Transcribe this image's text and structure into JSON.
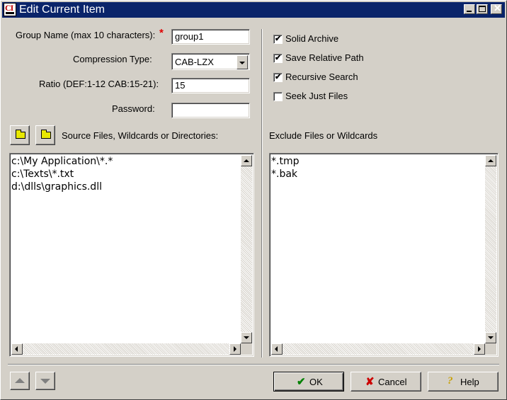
{
  "window": {
    "icon_text": "CI",
    "title": "Edit Current Item",
    "minimize_icon": "minimize-icon",
    "maximize_icon": "maximize-icon",
    "close_icon": "close-icon"
  },
  "form": {
    "group_name_label": "Group Name (max 10 characters):",
    "required_mark": "*",
    "group_name_value": "group1",
    "compression_label": "Compression Type:",
    "compression_value": "CAB-LZX",
    "ratio_label": "Ratio (DEF:1-12 CAB:15-21):",
    "ratio_value": "15",
    "password_label": "Password:",
    "password_value": ""
  },
  "options": [
    {
      "label": "Solid Archive",
      "checked": true
    },
    {
      "label": "Save Relative Path",
      "checked": true
    },
    {
      "label": "Recursive Search",
      "checked": true
    },
    {
      "label": "Seek Just Files",
      "checked": false
    }
  ],
  "source": {
    "label": "Source Files, Wildcards or Directories:",
    "items": [
      "c:\\My Application\\*.*",
      "c:\\Texts\\*.txt",
      "d:\\dlls\\graphics.dll"
    ]
  },
  "exclude": {
    "label": "Exclude Files or Wildcards",
    "items": [
      "*.tmp",
      "*.bak"
    ]
  },
  "buttons": {
    "ok": "OK",
    "cancel": "Cancel",
    "help": "Help",
    "ok_icon": "checkmark-icon",
    "cancel_icon": "x-icon",
    "help_icon": "question-icon"
  },
  "colors": {
    "titlebar": "#0a246a",
    "face": "#d4d0c8",
    "required": "#e00000",
    "ok_check": "#008000",
    "cancel_x": "#cc0000",
    "help_q": "#c8a000"
  }
}
